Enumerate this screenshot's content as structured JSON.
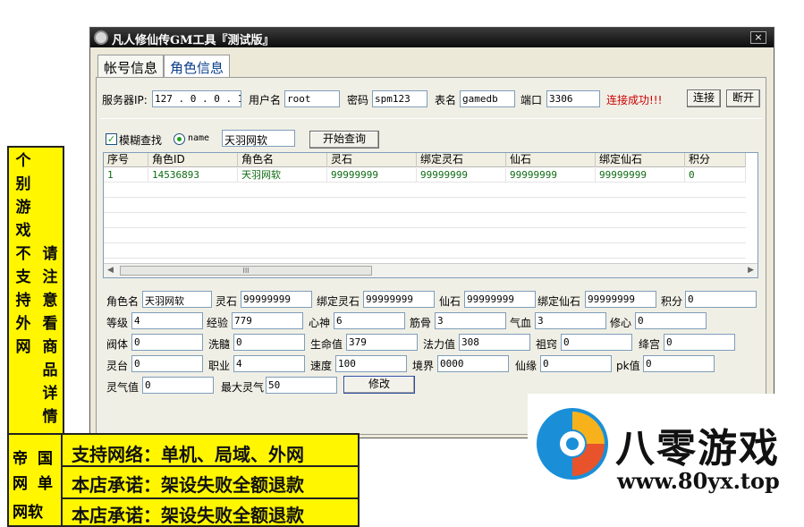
{
  "window": {
    "title": "凡人修仙传GM工具『测试版』",
    "close_label": "×"
  },
  "tabs": [
    {
      "label": "帐号信息",
      "active": false
    },
    {
      "label": "角色信息",
      "active": true
    }
  ],
  "connection": {
    "server_ip_label": "服务器IP:",
    "server_ip_value": "127 . 0 . 0 . 1",
    "user_label": "用户名",
    "user_value": "root",
    "password_label": "密码",
    "password_value": "spm123",
    "table_label": "表名",
    "table_value": "gamedb",
    "port_label": "端口",
    "port_value": "3306",
    "status_text": "连接成功!!!",
    "status_color": "#cc0000",
    "connect_button": "连接",
    "disconnect_button": "断开"
  },
  "search": {
    "fuzzy_label": "模糊查找",
    "fuzzy_checked": true,
    "mode_label": "name",
    "query_value": "天羽网软",
    "start_button": "开始查询"
  },
  "grid": {
    "headers": [
      "序号",
      "角色ID",
      "角色名",
      "灵石",
      "绑定灵石",
      "仙石",
      "绑定仙石",
      "积分"
    ],
    "rows": [
      [
        "1",
        "14536893",
        "天羽网软",
        "99999999",
        "99999999",
        "99999999",
        "99999999",
        "0"
      ]
    ],
    "scroll_thumb": "III"
  },
  "detail": {
    "role_name_label": "角色名",
    "role_name_value": "天羽网软",
    "lingshi_label": "灵石",
    "lingshi_value": "99999999",
    "bind_lingshi_label": "绑定灵石",
    "bind_lingshi_value": "99999999",
    "xianshi_label": "仙石",
    "xianshi_value": "99999999",
    "bind_xianshi_label": "绑定仙石",
    "bind_xianshi_value": "99999999",
    "score_label": "积分",
    "score_value": "0",
    "level_label": "等级",
    "level_value": "4",
    "exp_label": "经验",
    "exp_value": "779",
    "xinshen_label": "心神",
    "xinshen_value": "6",
    "jingu_label": "筋骨",
    "jingu_value": "3",
    "qixue_label": "气血",
    "qixue_value": "3",
    "xiuxin_label": "修心",
    "xiuxin_value": "0",
    "koti_label": "阀体",
    "koti_value": "0",
    "xisui_label": "洗髓",
    "xisui_value": "0",
    "hp_label": "生命值",
    "hp_value": "379",
    "mp_label": "法力值",
    "mp_value": "308",
    "zuqiao_label": "祖窍",
    "zuqiao_value": "0",
    "jianggong_label": "绛宫",
    "jianggong_value": "0",
    "lingtai_label": "灵台",
    "lingtai_value": "0",
    "job_label": "职业",
    "job_value": "4",
    "speed_label": "速度",
    "speed_value": "100",
    "realm_label": "境界",
    "realm_value": "0000",
    "xianyuan_label": "仙缘",
    "xianyuan_value": "0",
    "pk_label": "pk值",
    "pk_value": "0",
    "lingqi_label": "灵气值",
    "lingqi_value": "0",
    "max_lingqi_label": "最大灵气",
    "max_lingqi_value": "50",
    "modify_button": "修改"
  },
  "ad_vertical": {
    "col_left": [
      "个",
      "别",
      "游",
      "戏",
      "不",
      "支",
      "持",
      "外",
      "网"
    ],
    "col_right": [
      "请",
      "注",
      "意",
      "看",
      "商",
      "品",
      "详",
      "情"
    ],
    "color": "#fff600"
  },
  "ad_horizontal": {
    "side_top": [
      "帝",
      "国"
    ],
    "side_mid": [
      "网",
      "单"
    ],
    "line1": "支持网络：单机、局域、外网",
    "line2": "本店承诺：架设失败全额退款",
    "line3_side": "网软",
    "line3": "本店承诺：架设失败全额退款"
  },
  "logo": {
    "name": "八零游戏",
    "url": "www.80yx.top"
  }
}
